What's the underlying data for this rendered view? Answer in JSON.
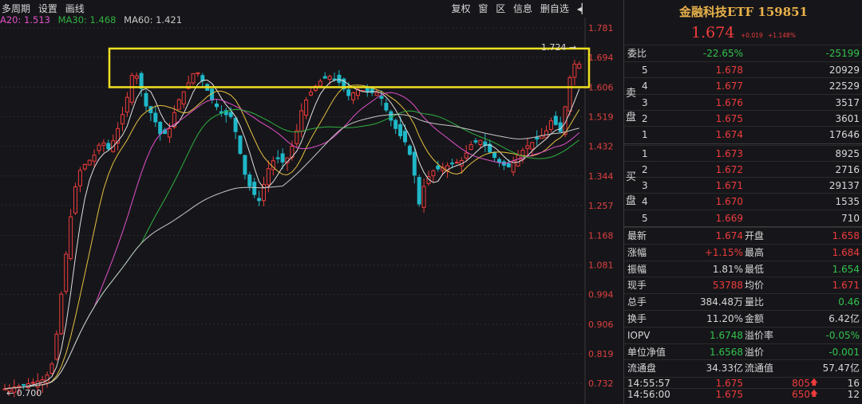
{
  "toolbar": {
    "left": [
      "多周期",
      "设置",
      "画线"
    ],
    "right": [
      "复权",
      "窗",
      "区",
      "信息",
      "删自选"
    ],
    "collapse_icon": "collapse-right-icon"
  },
  "ma": {
    "ma20": "A20: 1.513",
    "ma30": "MA30: 1.468",
    "ma60": "MA60: 1.421"
  },
  "chart_data": {
    "type": "candlestick",
    "y_ticks": [
      "1.781",
      "1.694",
      "1.606",
      "1.519",
      "1.432",
      "1.344",
      "1.257",
      "1.168",
      "1.081",
      "0.994",
      "0.906",
      "0.819",
      "0.732"
    ],
    "ylim": [
      0.7,
      1.8
    ],
    "max_label": "1.724",
    "min_label": "0.700",
    "highlight_box": {
      "from": 1.606,
      "to": 1.72,
      "color": "#f0e020"
    },
    "colors": {
      "up": "#ef3b3b",
      "down": "#1fb8c8",
      "ma5": "#e0e0e0",
      "ma10": "#e8c040",
      "ma20": "#e050c8",
      "ma30": "#30b040",
      "ma60": "#c8c8c8"
    }
  },
  "quote": {
    "title": "金融科技ETF 159851",
    "price": "1.674",
    "change": "+0.019",
    "change_pct": "+1.148%",
    "weibi_label": "委比",
    "weibi_pct": "-22.65%",
    "weibi_val": "-25199",
    "sell_label": "卖盘",
    "buy_label": "买盘",
    "sell": [
      {
        "lvl": "5",
        "price": "1.678",
        "vol": "20929"
      },
      {
        "lvl": "4",
        "price": "1.677",
        "vol": "22529"
      },
      {
        "lvl": "3",
        "price": "1.676",
        "vol": "3517"
      },
      {
        "lvl": "2",
        "price": "1.675",
        "vol": "3601"
      },
      {
        "lvl": "1",
        "price": "1.674",
        "vol": "17646"
      }
    ],
    "buy": [
      {
        "lvl": "1",
        "price": "1.673",
        "vol": "8925"
      },
      {
        "lvl": "2",
        "price": "1.672",
        "vol": "2716"
      },
      {
        "lvl": "3",
        "price": "1.671",
        "vol": "29137"
      },
      {
        "lvl": "4",
        "price": "1.670",
        "vol": "1535"
      },
      {
        "lvl": "5",
        "price": "1.669",
        "vol": "710"
      }
    ],
    "stats": [
      {
        "l1": "最新",
        "v1": "1.674",
        "c1": "red",
        "l2": "开盘",
        "v2": "1.658",
        "c2": "red"
      },
      {
        "l1": "涨幅",
        "v1": "+1.15%",
        "c1": "red",
        "l2": "最高",
        "v2": "1.684",
        "c2": "red"
      },
      {
        "l1": "振幅",
        "v1": "1.81%",
        "c1": "white",
        "l2": "最低",
        "v2": "1.654",
        "c2": "green"
      },
      {
        "l1": "现手",
        "v1": "53788",
        "c1": "red",
        "l2": "均价",
        "v2": "1.671",
        "c2": "red"
      },
      {
        "l1": "总手",
        "v1": "384.48万",
        "c1": "white",
        "l2": "量比",
        "v2": "0.46",
        "c2": "green"
      },
      {
        "l1": "换手",
        "v1": "11.20%",
        "c1": "white",
        "l2": "金额",
        "v2": "6.42亿",
        "c2": "white"
      },
      {
        "l1": "IOPV",
        "v1": "1.6748",
        "c1": "green",
        "l2": "溢价率",
        "v2": "-0.05%",
        "c2": "green"
      },
      {
        "l1": "单位净值",
        "v1": "1.6568",
        "c1": "green",
        "l2": "溢价",
        "v2": "-0.001",
        "c2": "green"
      },
      {
        "l1": "流通盘",
        "v1": "34.33亿",
        "c1": "white",
        "l2": "流通值",
        "v2": "57.47亿",
        "c2": "white"
      }
    ],
    "ticks": [
      {
        "time": "14:55:57",
        "price": "1.675",
        "vol": "805",
        "num": "16"
      },
      {
        "time": "14:56:00",
        "price": "1.675",
        "vol": "650",
        "num": "12"
      }
    ]
  }
}
